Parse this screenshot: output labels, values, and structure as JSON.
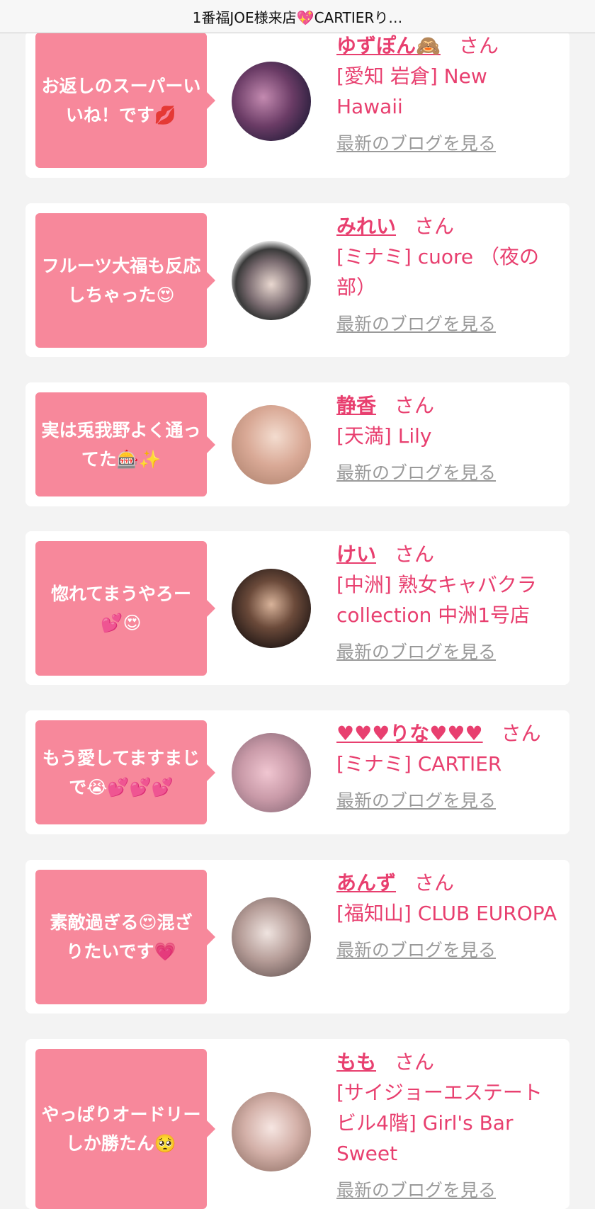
{
  "header": {
    "title": "1番福JOE様来店💖CARTIERり…"
  },
  "cards": [
    {
      "comment": "お返しのスーパーいいね！です💋",
      "name": "ゆずぽん🙈",
      "suffix": "さん",
      "shop": "[愛知 岩倉] New Hawaii",
      "blog_link": "最新のブログを見る",
      "avatar_colors": [
        "#2a1f3d",
        "#c38ab0"
      ]
    },
    {
      "comment": "フルーツ大福も反応しちゃった😍",
      "name": "みれい",
      "suffix": "さん",
      "shop": "[ミナミ] cuore （夜の部）",
      "blog_link": "最新のブログを見る",
      "avatar_colors": [
        "#f4f4f4",
        "#3a3a3a"
      ]
    },
    {
      "comment": "実は兎我野よく通ってた🎰✨",
      "name": "静香",
      "suffix": "さん",
      "shop": "[天満] Lily",
      "blog_link": "最新のブログを見る",
      "avatar_colors": [
        "#e8c9b6",
        "#b98c78"
      ]
    },
    {
      "comment": "惚れてまうやろー💕😍",
      "name": "けい",
      "suffix": "さん",
      "shop": "[中洲] 熟女キャバクラ collection 中洲1号店",
      "blog_link": "最新のブログを見る",
      "avatar_colors": [
        "#2b1e1a",
        "#6b4a3a"
      ]
    },
    {
      "comment": "もう愛してますまじで😭💕💕💕",
      "name": "♥♥♥りな♥♥♥",
      "suffix": "さん",
      "shop": "[ミナミ] CARTIER",
      "blog_link": "最新のブログを見る",
      "avatar_colors": [
        "#f0c6d1",
        "#8d6c7a"
      ]
    },
    {
      "comment": "素敵過ぎる😍混ざりたいです💗",
      "name": "あんず",
      "suffix": "さん",
      "shop": "[福知山] CLUB EUROPA",
      "blog_link": "最新のブログを見る",
      "avatar_colors": [
        "#efe4e0",
        "#6b5a58"
      ]
    },
    {
      "comment": "やっぱりオードリーしか勝たん🥺",
      "name": "もも",
      "suffix": "さん",
      "shop": "[サイジョーエステート ビル4階] Girl's Bar Sweet",
      "blog_link": "最新のブログを見る",
      "avatar_colors": [
        "#f2dcd8",
        "#9a7a70"
      ]
    }
  ]
}
